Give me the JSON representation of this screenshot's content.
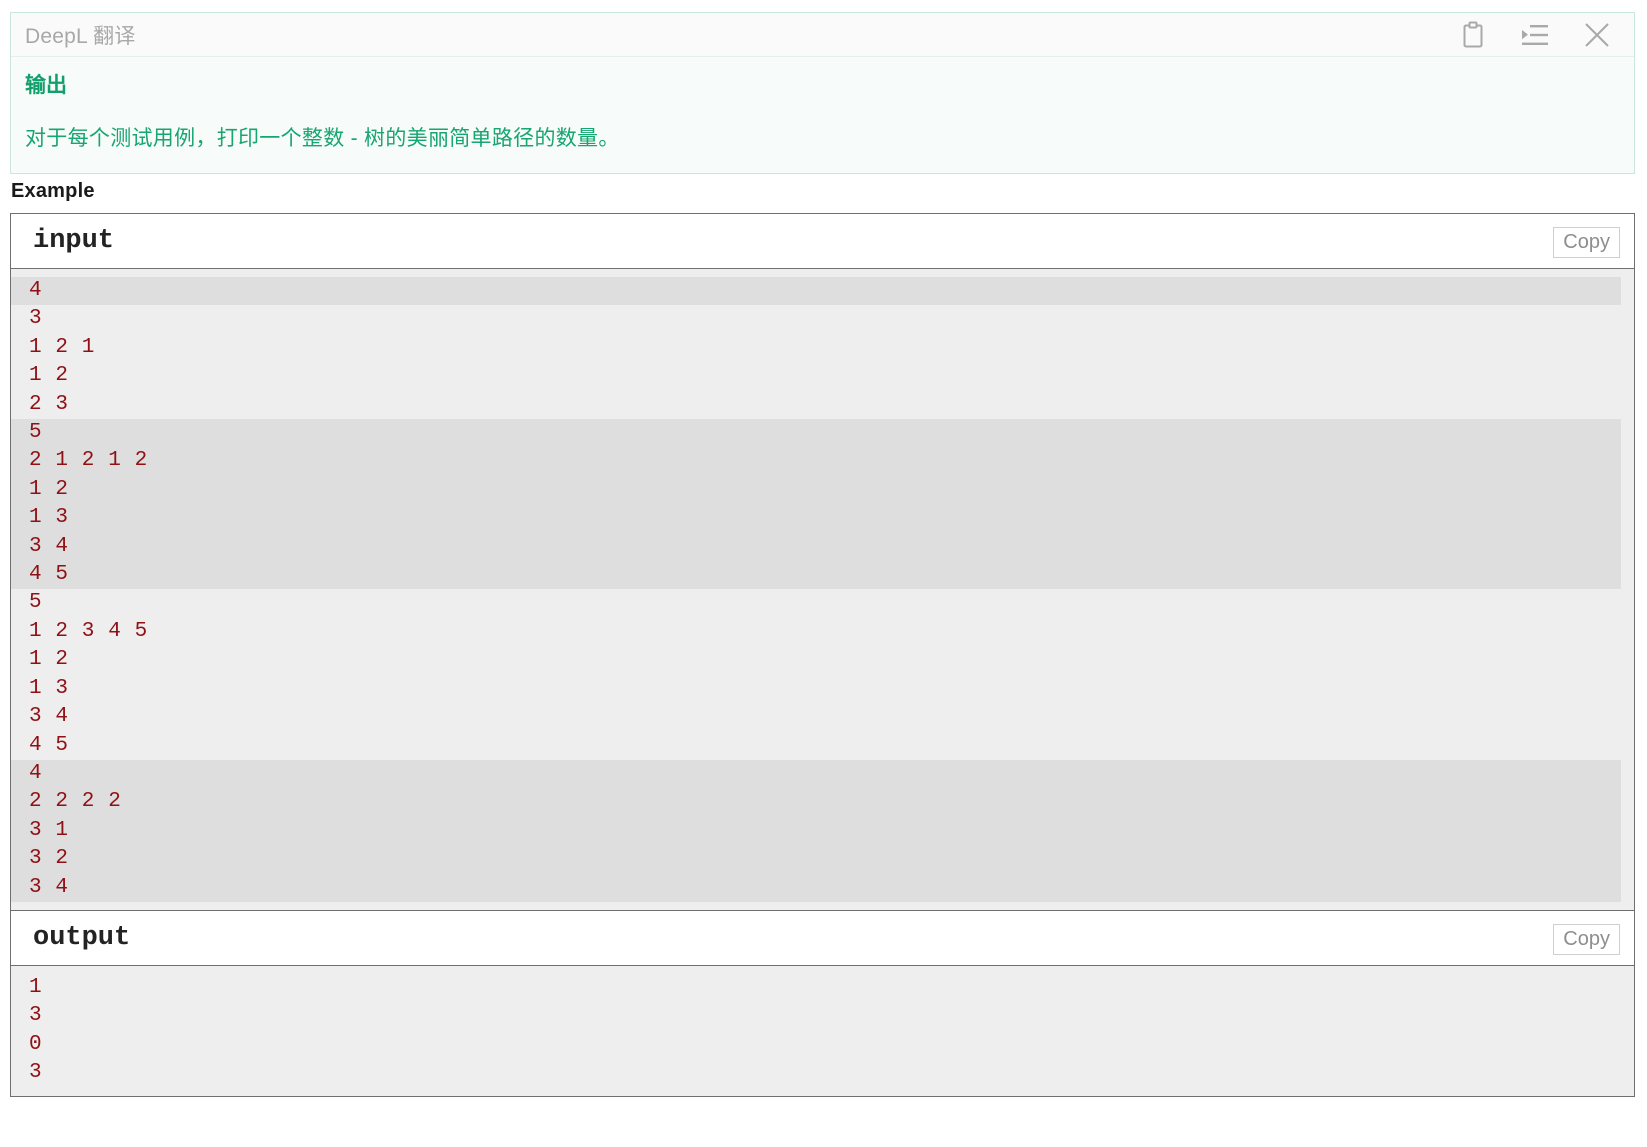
{
  "translator_panel": {
    "title": "DeepL 翻译",
    "section_heading": "输出",
    "paragraph": "对于每个测试用例，打印一个整数 - 树的美丽简单路径的数量。",
    "accent_color": "#11a06c",
    "border_color": "#cbe7dc",
    "icons": {
      "clipboard": "clipboard-icon",
      "indent": "text-indent-icon",
      "close": "close-icon"
    }
  },
  "example": {
    "heading": "Example",
    "blocks": [
      {
        "label": "input",
        "copy_label": "Copy",
        "groups": [
          {
            "shaded": true,
            "lines": [
              "4"
            ]
          },
          {
            "shaded": false,
            "lines": [
              "3",
              "1 2 1",
              "1 2",
              "2 3"
            ]
          },
          {
            "shaded": true,
            "lines": [
              "5",
              "2 1 2 1 2",
              "1 2",
              "1 3",
              "3 4",
              "4 5"
            ]
          },
          {
            "shaded": false,
            "lines": [
              "5",
              "1 2 3 4 5",
              "1 2",
              "1 3",
              "3 4",
              "4 5"
            ]
          },
          {
            "shaded": true,
            "lines": [
              "4",
              "2 2 2 2",
              "3 1",
              "3 2",
              "3 4"
            ]
          }
        ]
      },
      {
        "label": "output",
        "copy_label": "Copy",
        "groups": [
          {
            "shaded": false,
            "lines": [
              "1",
              "3",
              "0",
              "3"
            ]
          }
        ]
      }
    ]
  },
  "colors": {
    "code_text": "#8f1015",
    "code_bg_light": "#eeeeee",
    "code_bg_shaded": "#dedede",
    "block_border": "#6f6f6f"
  }
}
